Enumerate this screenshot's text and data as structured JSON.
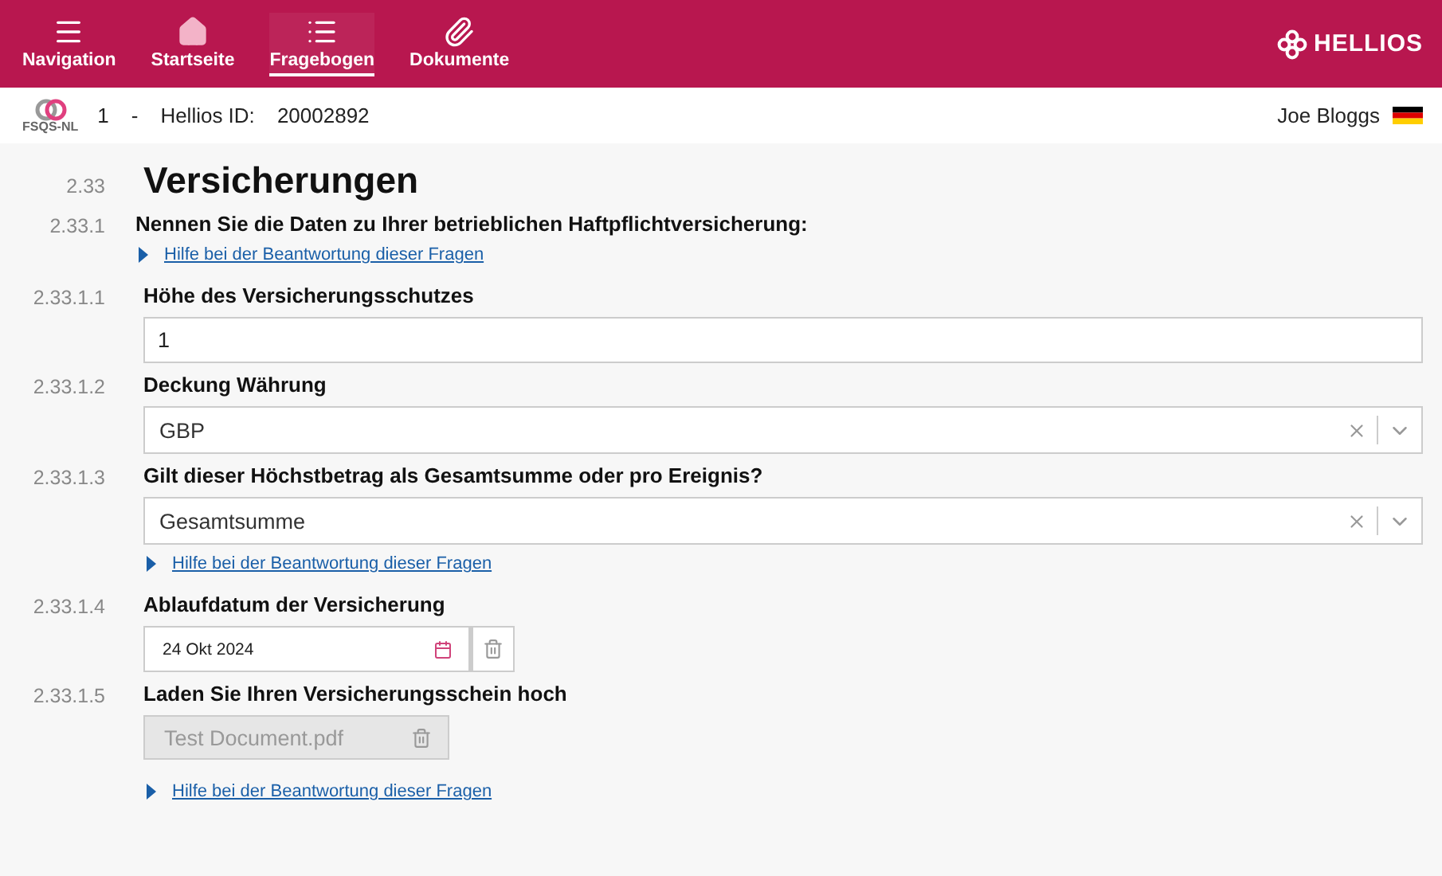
{
  "nav": {
    "items": [
      {
        "label": "Navigation",
        "selected": false
      },
      {
        "label": "Startseite",
        "selected": false
      },
      {
        "label": "Fragebogen",
        "selected": true
      },
      {
        "label": "Dokumente",
        "selected": false
      }
    ],
    "brand": "HELLIOS"
  },
  "info_bar": {
    "logo_text": "FSQS-NL",
    "number": "1",
    "separator": "-",
    "id_label": "Hellios ID:",
    "id_value": "20002892",
    "user": "Joe Bloggs"
  },
  "section": {
    "number": "2.33",
    "title": "Versicherungen"
  },
  "items": [
    {
      "number": "2.33.1",
      "label": "Nennen Sie die Daten zu Ihrer betrieblichen Haftpflichtversicherung:",
      "kind": "heading",
      "help": "Hilfe bei der Beantwortung dieser Fragen"
    },
    {
      "number": "2.33.1.1",
      "label": "Höhe des Versicherungsschutzes",
      "kind": "text",
      "value": "1"
    },
    {
      "number": "2.33.1.2",
      "label": "Deckung Währung",
      "kind": "select",
      "value": "GBP"
    },
    {
      "number": "2.33.1.3",
      "label": "Gilt dieser Höchstbetrag als Gesamtsumme oder pro Ereignis?",
      "kind": "select",
      "value": "Gesamtsumme",
      "help": "Hilfe bei der Beantwortung dieser Fragen"
    },
    {
      "number": "2.33.1.4",
      "label": "Ablaufdatum der Versicherung",
      "kind": "date",
      "value": "24 Okt 2024"
    },
    {
      "number": "2.33.1.5",
      "label": "Laden Sie Ihren Versicherungsschein hoch",
      "kind": "file",
      "value": "Test Document.pdf",
      "help": "Hilfe bei der Beantwortung dieser Fragen"
    }
  ]
}
